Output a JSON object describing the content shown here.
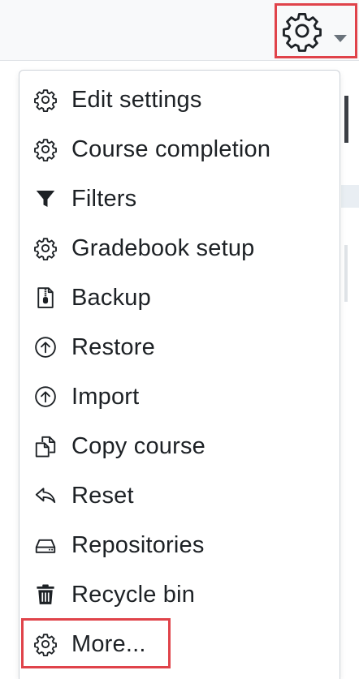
{
  "header": {
    "settings_icon": "gear-icon",
    "dropdown_icon": "caret-down-icon",
    "highlight_color": "#e0434a"
  },
  "menu": {
    "items": [
      {
        "label": "Edit settings",
        "icon": "gear-icon"
      },
      {
        "label": "Course completion",
        "icon": "gear-icon"
      },
      {
        "label": "Filters",
        "icon": "filter-icon"
      },
      {
        "label": "Gradebook setup",
        "icon": "gear-icon"
      },
      {
        "label": "Backup",
        "icon": "file-zip-icon"
      },
      {
        "label": "Restore",
        "icon": "arrow-up-circle-icon"
      },
      {
        "label": "Import",
        "icon": "arrow-up-circle-icon"
      },
      {
        "label": "Copy course",
        "icon": "copy-icon"
      },
      {
        "label": "Reset",
        "icon": "reply-icon"
      },
      {
        "label": "Repositories",
        "icon": "hard-drive-icon"
      },
      {
        "label": "Recycle bin",
        "icon": "trash-icon"
      },
      {
        "label": "More...",
        "icon": "gear-icon"
      }
    ]
  }
}
